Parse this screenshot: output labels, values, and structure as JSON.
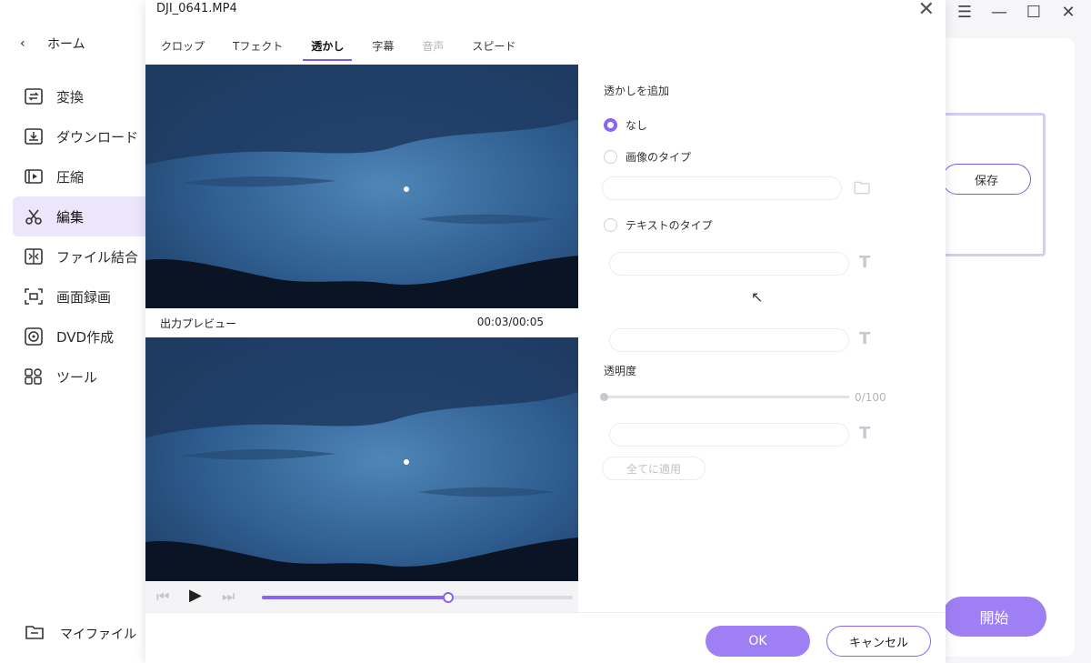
{
  "sidebar": {
    "home": "ホーム",
    "items": [
      {
        "label": "変換",
        "icon": "convert-icon"
      },
      {
        "label": "ダウンロード",
        "icon": "download-icon"
      },
      {
        "label": "圧縮",
        "icon": "compress-icon"
      },
      {
        "label": "編集",
        "icon": "scissors-icon",
        "active": true
      },
      {
        "label": "ファイル結合",
        "icon": "merge-icon"
      },
      {
        "label": "画面録画",
        "icon": "screen-record-icon"
      },
      {
        "label": "DVD作成",
        "icon": "dvd-icon"
      },
      {
        "label": "ツール",
        "icon": "tools-icon"
      }
    ],
    "my_files": "マイファイル"
  },
  "dialog": {
    "title": "DJI_0641.MP4",
    "tabs": [
      {
        "label": "クロップ",
        "state": "normal"
      },
      {
        "label": "Tフェクト",
        "state": "normal"
      },
      {
        "label": "透かし",
        "state": "active"
      },
      {
        "label": "字幕",
        "state": "normal"
      },
      {
        "label": "音声",
        "state": "disabled"
      },
      {
        "label": "スピード",
        "state": "normal"
      }
    ],
    "output_preview_label": "出力プレビュー",
    "time": "00:03/00:05",
    "playback_progress": 0.6,
    "watermark": {
      "section_title": "透かしを追加",
      "option_none": "なし",
      "option_image": "画像のタイプ",
      "option_text": "テキストのタイプ",
      "selected": "none",
      "opacity_label": "透明度",
      "opacity_value": "0/100",
      "apply_all": "全てに適用"
    },
    "ok": "OK",
    "cancel": "キャンセル"
  },
  "background_app": {
    "save": "保存",
    "start": "開始"
  },
  "colors": {
    "accent": "#8b64f3",
    "accent_light": "#9f80f4",
    "sidebar_active": "#ece6fb"
  }
}
